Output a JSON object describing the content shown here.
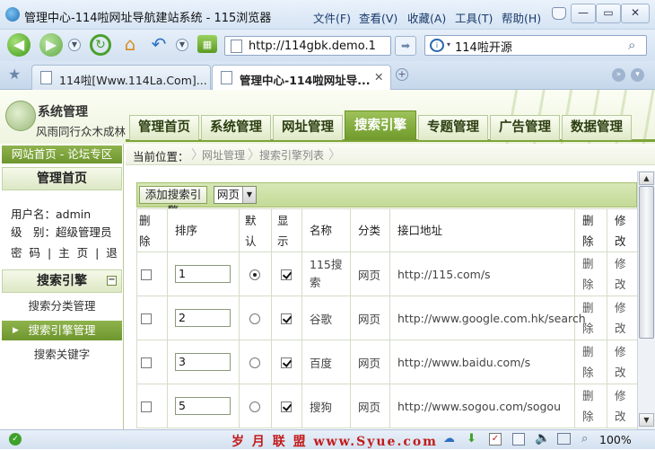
{
  "browser": {
    "window_title": "管理中心-114啦网址导航建站系统 - 115浏览器",
    "menus": [
      "文件(F)",
      "查看(V)",
      "收藏(A)",
      "工具(T)",
      "帮助(H)"
    ],
    "address": "http://114gbk.demo.1",
    "search_text": "114啦开源",
    "tabs": [
      {
        "label": "114啦[Www.114La.Com]...",
        "active": false
      },
      {
        "label": "管理中心-114啦网址导...",
        "active": true
      }
    ],
    "status": {
      "zoom": "100%",
      "watermark": "岁 月 联 盟  www.Syue.com"
    }
  },
  "app": {
    "logo_title": "系统管理",
    "logo_subtitle": "风雨同行众木成林",
    "nav_tabs": [
      "管理首页",
      "系统管理",
      "网址管理",
      "搜索引擎",
      "专题管理",
      "广告管理",
      "数据管理"
    ],
    "active_nav": "搜索引擎"
  },
  "sidebar": {
    "top_link": "网站首页 - 论坛专区",
    "home_heading": "管理首页",
    "user_line": "用户名：admin",
    "level_line": "级　别：超级管理员",
    "links_line": "密 码 | 主 页 | 退 出",
    "section_heading": "搜索引擎",
    "collapse_symbol": "−",
    "items": [
      "搜索分类管理",
      "搜索引擎管理",
      "搜索关键字"
    ],
    "active_item": "搜索引擎管理"
  },
  "breadcrumb": {
    "label": "当前位置：",
    "items": [
      "网址管理",
      "搜索引擎列表"
    ]
  },
  "actions": {
    "add_button": "添加搜索引擎",
    "filter_value": "网页"
  },
  "table": {
    "headers": {
      "delete_select": "删除",
      "order": "排序",
      "default": "默认",
      "display": "显示",
      "name": "名称",
      "category": "分类",
      "api": "接口地址",
      "delete": "删除",
      "edit": "修改"
    },
    "rows": [
      {
        "order": "1",
        "default": true,
        "display": true,
        "name": "115搜索",
        "category": "网页",
        "api": "http://115.com/s",
        "delete": "删除",
        "edit": "修改"
      },
      {
        "order": "2",
        "default": false,
        "display": true,
        "name": "谷歌",
        "category": "网页",
        "api": "http://www.google.com.hk/search",
        "delete": "删除",
        "edit": "修改"
      },
      {
        "order": "3",
        "default": false,
        "display": true,
        "name": "百度",
        "category": "网页",
        "api": "http://www.baidu.com/s",
        "delete": "删除",
        "edit": "修改"
      },
      {
        "order": "5",
        "default": false,
        "display": true,
        "name": "搜狗",
        "category": "网页",
        "api": "http://www.sogou.com/sogou",
        "delete": "删除",
        "edit": "修改"
      }
    ]
  }
}
